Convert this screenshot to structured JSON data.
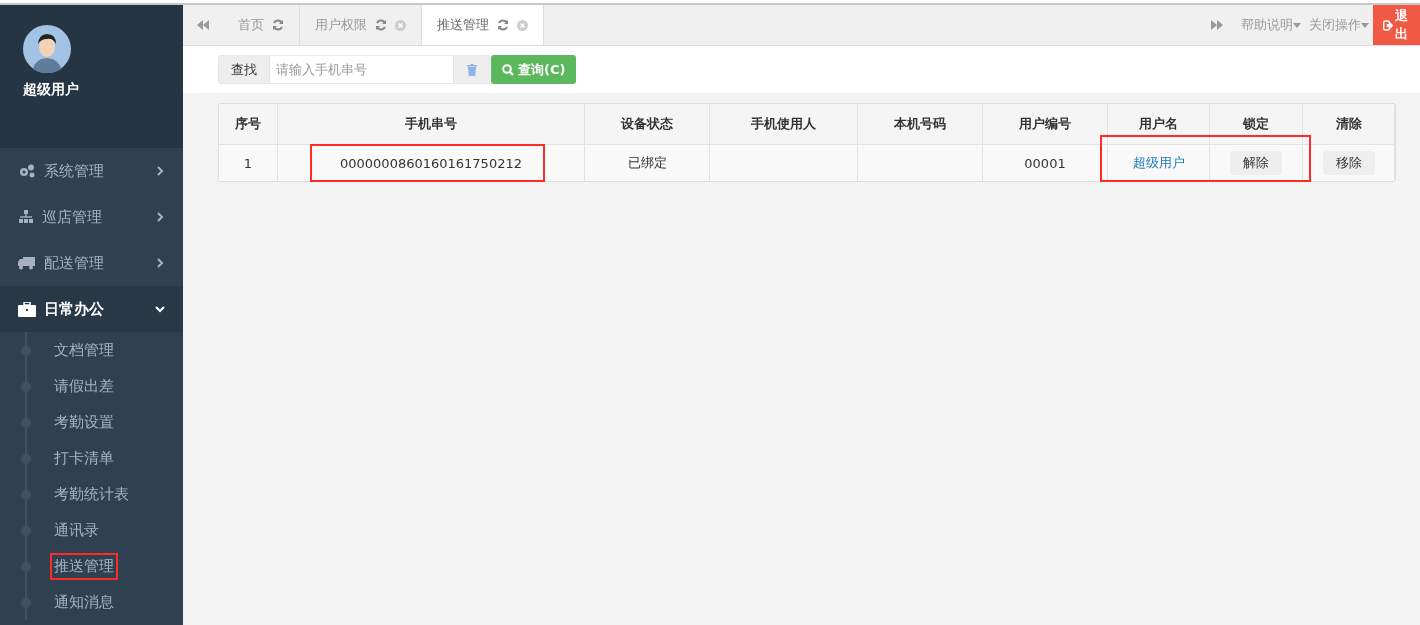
{
  "sidebar": {
    "user": {
      "name": "超级用户"
    },
    "menu": [
      {
        "label": "系统管理",
        "kind": "gears",
        "expanded": false
      },
      {
        "label": "巡店管理",
        "kind": "sitemap",
        "expanded": false
      },
      {
        "label": "配送管理",
        "kind": "truck",
        "expanded": false
      },
      {
        "label": "日常办公",
        "kind": "briefcase",
        "expanded": true,
        "children": [
          {
            "label": "文档管理",
            "highlighted": false
          },
          {
            "label": "请假出差",
            "highlighted": false
          },
          {
            "label": "考勤设置",
            "highlighted": false
          },
          {
            "label": "打卡清单",
            "highlighted": false
          },
          {
            "label": "考勤统计表",
            "highlighted": false
          },
          {
            "label": "通讯录",
            "highlighted": false
          },
          {
            "label": "推送管理",
            "highlighted": true
          },
          {
            "label": "通知消息",
            "highlighted": false
          }
        ]
      }
    ]
  },
  "tabs": [
    {
      "label": "首页",
      "selected": false,
      "closable": false
    },
    {
      "label": "用户权限",
      "selected": false,
      "closable": true
    },
    {
      "label": "推送管理",
      "selected": true,
      "closable": true
    }
  ],
  "top_actions": [
    "帮助说明",
    "关闭操作"
  ],
  "logout": "退出",
  "search": {
    "label": "查找",
    "placeholder": "请输入手机串号",
    "button": "查询(C)"
  },
  "table": {
    "columns": [
      "序号",
      "手机串号",
      "设备状态",
      "手机使用人",
      "本机号码",
      "用户编号",
      "用户名",
      "锁定",
      "清除"
    ],
    "rows": [
      [
        {
          "text": "1",
          "kind": "text",
          "highlighted": false
        },
        {
          "text": "0000000860160161750212",
          "kind": "text",
          "highlighted": true
        },
        {
          "text": "已绑定",
          "kind": "text",
          "highlighted": false
        },
        {
          "text": "",
          "kind": "text",
          "highlighted": false
        },
        {
          "text": "",
          "kind": "text",
          "highlighted": false
        },
        {
          "text": "00001",
          "kind": "text",
          "highlighted": false
        },
        {
          "text": "超级用户",
          "kind": "link",
          "highlighted": true
        },
        {
          "text": "解除",
          "kind": "button",
          "highlighted": true
        },
        {
          "text": "移除",
          "kind": "button",
          "highlighted": false
        }
      ]
    ]
  }
}
